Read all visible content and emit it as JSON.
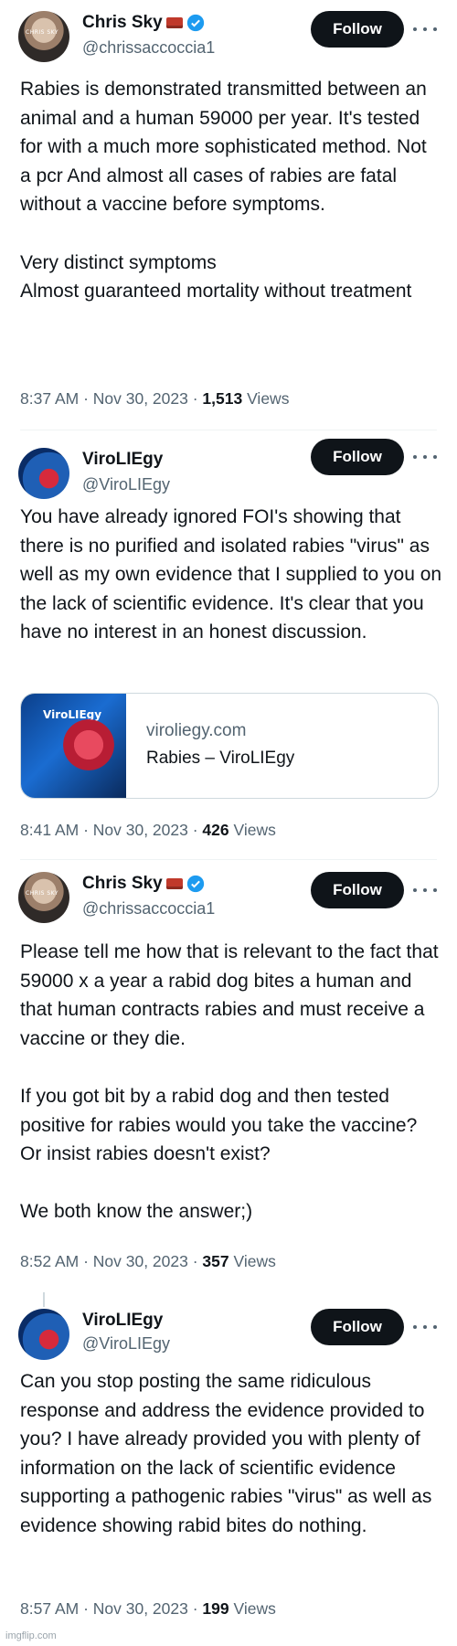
{
  "tweets": [
    {
      "display_name": "Chris Sky",
      "handle": "@chrissaccoccia1",
      "avatar_text": "CHRIS SKY",
      "follow_label": "Follow",
      "text": "Rabies is demonstrated transmitted between an animal and a human 59000 per year. It's tested for with a much more sophisticated method. Not a pcr And almost all cases of rabies are fatal without a vaccine before symptoms.\n\nVery distinct symptoms\nAlmost guaranteed mortality without treatment",
      "time": "8:37 AM · Nov 30, 2023 · ",
      "views_count": "1,513",
      "views_label": " Views",
      "verified": true
    },
    {
      "display_name": "ViroLIEgy",
      "handle": "@ViroLIEgy",
      "follow_label": "Follow",
      "text": "You have already ignored FOI's showing that there is no purified and isolated rabies \"virus\" as well as my own evidence that I supplied to you on the lack of scientific evidence. It's clear that you have no interest in an honest discussion.",
      "card": {
        "logo_text": "ViroLIEgy",
        "domain": "viroliegy.com",
        "title": "Rabies – ViroLIEgy"
      },
      "time": "8:41 AM · Nov 30, 2023 · ",
      "views_count": "426",
      "views_label": " Views",
      "verified": false
    },
    {
      "display_name": "Chris Sky",
      "handle": "@chrissaccoccia1",
      "avatar_text": "CHRIS SKY",
      "follow_label": "Follow",
      "text": "Please tell me how that is relevant to the fact that 59000 x a year a rabid dog bites a human and that human contracts rabies and must receive a vaccine or they die.\n\nIf you got bit by a rabid dog and then tested positive for rabies would you take the vaccine? Or insist rabies doesn't exist?\n\nWe both know the answer;)",
      "time": "8:52 AM · Nov 30, 2023 · ",
      "views_count": "357",
      "views_label": " Views",
      "verified": true
    },
    {
      "display_name": "ViroLIEgy",
      "handle": "@ViroLIEgy",
      "follow_label": "Follow",
      "text": "Can you stop posting the same ridiculous response and address the evidence provided to you? I have already provided you with plenty of information on the lack of scientific evidence supporting a pathogenic rabies \"virus\" as well as evidence showing rabid bites do nothing.",
      "time": "8:57 AM · Nov 30, 2023 · ",
      "views_count": "199",
      "views_label": " Views",
      "verified": false
    }
  ],
  "watermark": "imgflip.com",
  "colors": {
    "text": "#0f1419",
    "secondary": "#536471",
    "verified": "#1d9bf0",
    "follow_bg": "#0f1419"
  }
}
